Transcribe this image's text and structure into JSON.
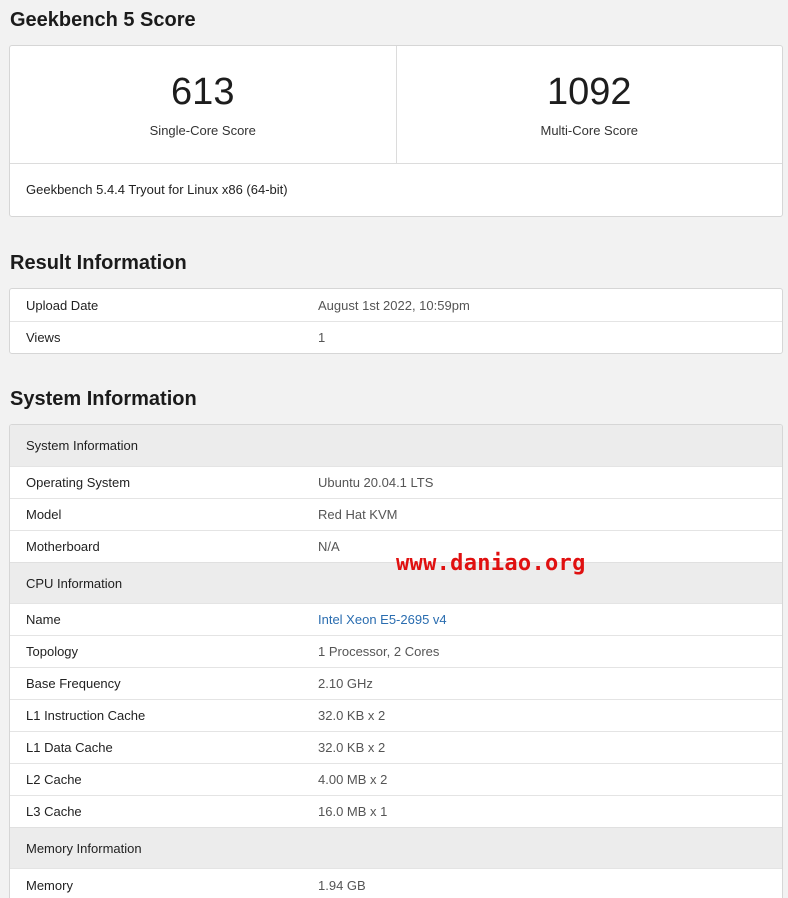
{
  "score_section": {
    "title": "Geekbench 5 Score",
    "single_core": {
      "value": "613",
      "label": "Single-Core Score"
    },
    "multi_core": {
      "value": "1092",
      "label": "Multi-Core Score"
    },
    "version": "Geekbench 5.4.4 Tryout for Linux x86 (64-bit)"
  },
  "result_section": {
    "title": "Result Information",
    "rows": [
      {
        "key": "Upload Date",
        "value": "August 1st 2022, 10:59pm"
      },
      {
        "key": "Views",
        "value": "1"
      }
    ]
  },
  "system_section": {
    "title": "System Information",
    "groups": [
      {
        "heading": "System Information",
        "rows": [
          {
            "key": "Operating System",
            "value": "Ubuntu 20.04.1 LTS"
          },
          {
            "key": "Model",
            "value": "Red Hat KVM"
          },
          {
            "key": "Motherboard",
            "value": "N/A"
          }
        ]
      },
      {
        "heading": "CPU Information",
        "rows": [
          {
            "key": "Name",
            "value": "Intel Xeon E5-2695 v4"
          },
          {
            "key": "Topology",
            "value": "1 Processor, 2 Cores"
          },
          {
            "key": "Base Frequency",
            "value": "2.10 GHz"
          },
          {
            "key": "L1 Instruction Cache",
            "value": "32.0 KB x 2"
          },
          {
            "key": "L1 Data Cache",
            "value": "32.0 KB x 2"
          },
          {
            "key": "L2 Cache",
            "value": "4.00 MB x 2"
          },
          {
            "key": "L3 Cache",
            "value": "16.0 MB x 1"
          }
        ]
      },
      {
        "heading": "Memory Information",
        "rows": [
          {
            "key": "Memory",
            "value": "1.94 GB"
          }
        ]
      }
    ]
  },
  "watermark": "www.daniao.org",
  "colors": {
    "link": "#2a6db0",
    "watermark": "#e01010",
    "background": "#f2f2f2"
  }
}
